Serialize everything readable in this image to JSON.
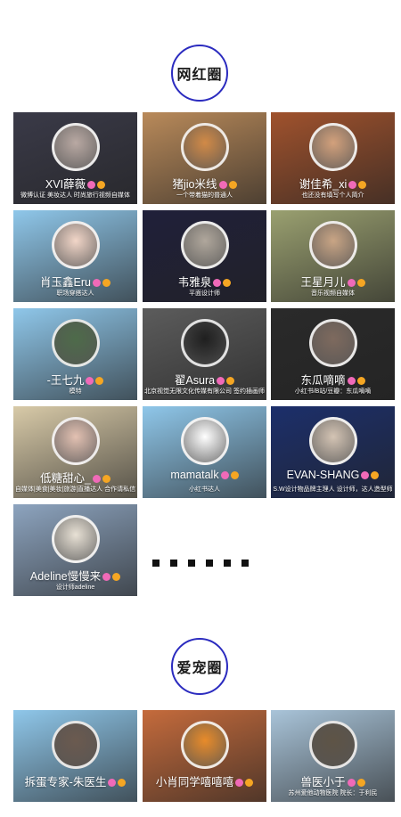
{
  "sections": {
    "influencers_title": "网红圈",
    "pets_title": "爱宠圈"
  },
  "influencers": [
    {
      "name": "XVI薛薇",
      "desc": "微博认证 美妆达人 时尚旅行视频自媒体",
      "bg": "#3a3a48",
      "avatar": "#b9a9a3"
    },
    {
      "name": "猪jio米线",
      "desc": "一个带着猫的普通人",
      "bg": "#b98a5a",
      "avatar": "#d18a47"
    },
    {
      "name": "谢佳希_xi",
      "desc": "也还没有填写个人简介",
      "bg": "#a0522d",
      "avatar": "#d3a17c"
    },
    {
      "name": "肖玉鑫Eru",
      "desc": "职场穿搭达人",
      "bg": "#8fc7ea",
      "avatar": "#f2d6c8"
    },
    {
      "name": "韦雅泉",
      "desc": "平面设计师",
      "bg": "#20203a",
      "avatar": "#b0a79c"
    },
    {
      "name": "王星月儿",
      "desc": "音乐视频自媒体",
      "bg": "#9aa070",
      "avatar": "#c9a585"
    },
    {
      "name": "-王七九",
      "desc": "模特",
      "bg": "#8fc7ea",
      "avatar": "#4e6b4a"
    },
    {
      "name": "翟Asura",
      "desc": "北京视觉无限文化传媒有限公司 签约插画师",
      "bg": "#5c5c5c",
      "avatar": "#1f1f1f"
    },
    {
      "name": "东瓜嘀嘀",
      "desc": "小红书/B站/豆瓣：东瓜嘀嘀",
      "bg": "#2a2a2a",
      "avatar": "#7e6a5e"
    },
    {
      "name": "低糖甜心_",
      "desc": "自媒体|美食|美妆|旅游|直播达人 合作请私信",
      "bg": "#d8caa8",
      "avatar": "#e3c1b2"
    },
    {
      "name": "mamatalk",
      "desc": "小红书达人",
      "bg": "#8fc7ea",
      "avatar": "#ffffff"
    },
    {
      "name": "EVAN-SHANG",
      "desc": "S.W设计物品牌主理人 设计师，达人造型师",
      "bg": "#1c2f6b",
      "avatar": "#d4c4b4"
    },
    {
      "name": "Adeline慢慢来",
      "desc": "设计师adeline",
      "bg": "#8da4bf",
      "avatar": "#e8e1d5"
    }
  ],
  "pets": [
    {
      "name": "拆蛋专家-朱医生",
      "desc": "",
      "bg": "#8fc7ea",
      "avatar": "#6b5a4f"
    },
    {
      "name": "小肖同学嘻嘻嘻",
      "desc": "",
      "bg": "#c56b3c",
      "avatar": "#e88b2a"
    },
    {
      "name": "兽医小于",
      "desc": "苏州爱他动物医院 院长：于利民",
      "bg": "#a9c4d9",
      "avatar": "#5e5446"
    }
  ],
  "more_indicator": "▪▪▪▪▪▪"
}
